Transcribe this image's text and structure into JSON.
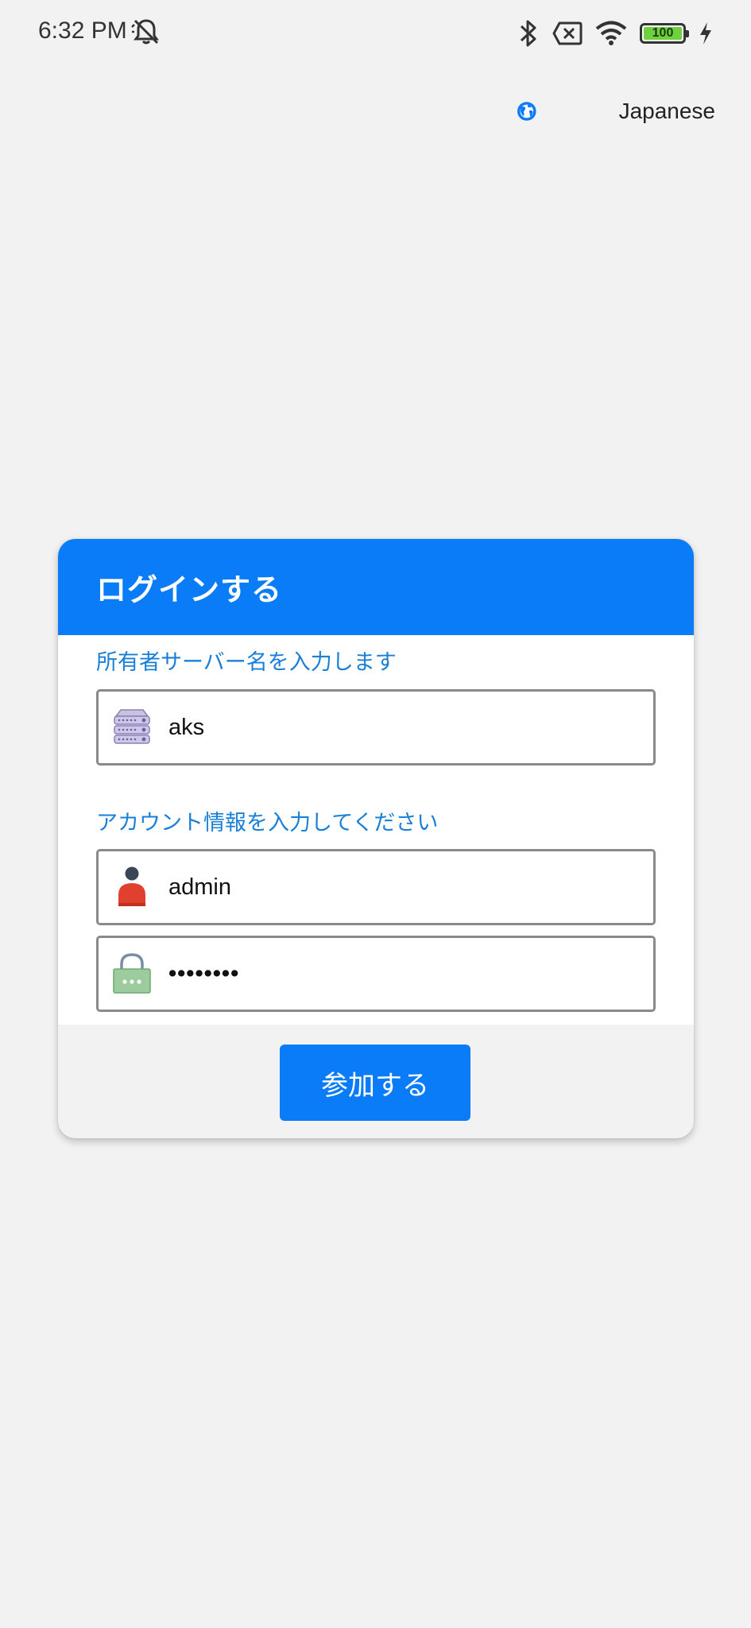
{
  "status_bar": {
    "time": "6:32 PM",
    "battery_level": "100",
    "battery_fraction": 1.0,
    "icons": [
      "bell-muted-icon",
      "bluetooth-icon",
      "no-sim-icon",
      "wifi-icon",
      "battery-icon",
      "charging-icon"
    ]
  },
  "language": {
    "label": "Japanese",
    "icon": "globe-icon"
  },
  "login": {
    "title": "ログインする",
    "server_section_label": "所有者サーバー名を入力します",
    "server_value": "aks",
    "account_section_label": "アカウント情報を入力してください",
    "username_value": "admin",
    "password_value": "••••••••",
    "submit_label": "参加する"
  },
  "colors": {
    "primary": "#0a7cf7",
    "label_blue": "#1a7fd6",
    "background": "#f2f2f2"
  }
}
